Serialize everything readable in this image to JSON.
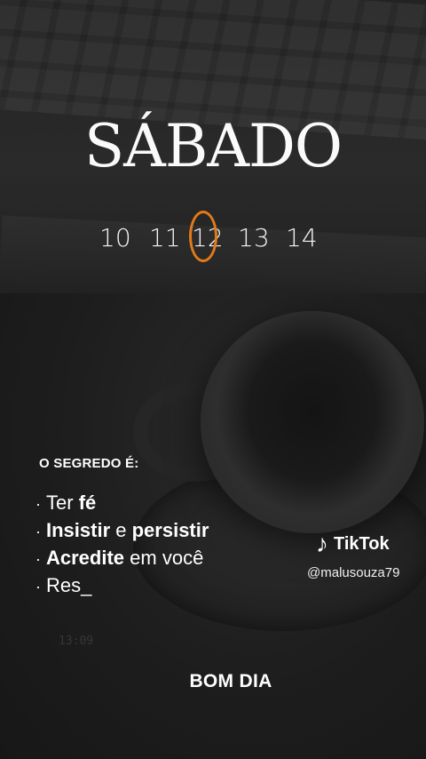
{
  "header": {
    "day_title": "SÁBADO"
  },
  "calendar": {
    "dates": [
      "10",
      "11",
      "12",
      "13",
      "14"
    ],
    "highlight_color": "#e27a1a",
    "selected_date": "12"
  },
  "message": {
    "title": "O SEGREDO É:",
    "items": [
      {
        "bullet": "·",
        "parts": [
          "Ter ",
          "fé"
        ]
      },
      {
        "bullet": "·",
        "parts": [
          "Insistir",
          " e ",
          "persistir"
        ]
      },
      {
        "bullet": "·",
        "parts": [
          "Acredite",
          " em você"
        ]
      },
      {
        "bullet": "·",
        "parts": [
          "Res_"
        ]
      }
    ]
  },
  "watermark": {
    "brand": "TikTok",
    "icon": "tiktok-note-icon",
    "handle": "@malusouza79"
  },
  "footer": {
    "greeting": "BOM DIA"
  },
  "background": {
    "ghost_time": "13:09"
  }
}
